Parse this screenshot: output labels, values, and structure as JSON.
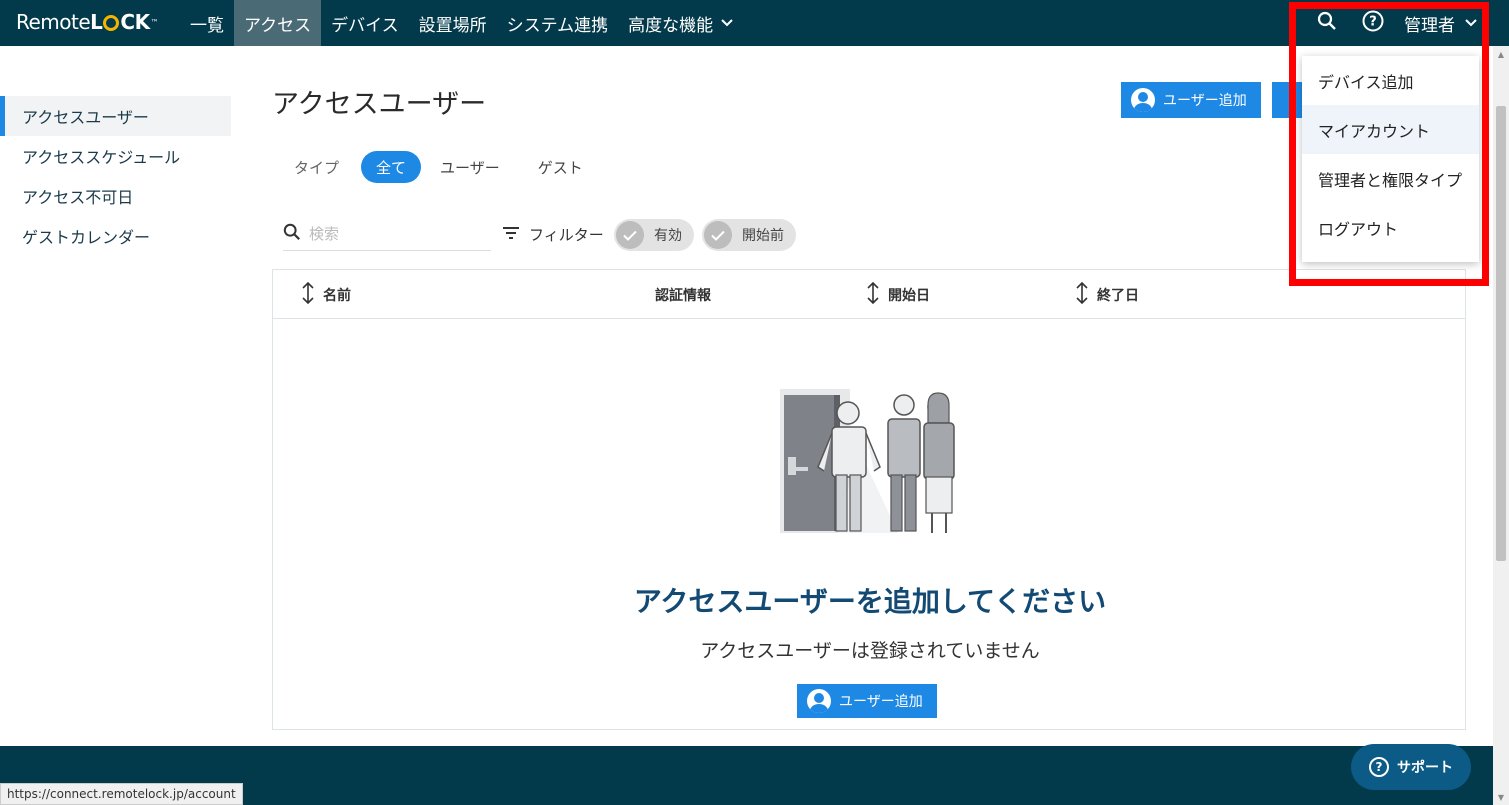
{
  "nav": {
    "logo_part1": "Remote",
    "logo_part2": "L",
    "logo_part3": "CK",
    "logo_tm": "™",
    "items": [
      {
        "label": "一覧"
      },
      {
        "label": "アクセス"
      },
      {
        "label": "デバイス"
      },
      {
        "label": "設置場所"
      },
      {
        "label": "システム連携"
      },
      {
        "label": "高度な機能"
      }
    ],
    "admin_label": "管理者",
    "icons": {
      "search": "search-icon",
      "help": "help-icon"
    }
  },
  "sidebar": {
    "items": [
      {
        "label": "アクセスユーザー"
      },
      {
        "label": "アクセススケジュール"
      },
      {
        "label": "アクセス不可日"
      },
      {
        "label": "ゲストカレンダー"
      }
    ]
  },
  "main": {
    "title": "アクセスユーザー",
    "add_user_label": "ユーザー追加",
    "type_label": "タイプ",
    "type_tabs": [
      {
        "label": "全て"
      },
      {
        "label": "ユーザー"
      },
      {
        "label": "ゲスト"
      }
    ],
    "search_placeholder": "検索",
    "filter_label": "フィルター",
    "chips": [
      {
        "label": "有効"
      },
      {
        "label": "開始前"
      }
    ]
  },
  "table": {
    "columns": [
      {
        "label": "名前"
      },
      {
        "label": "認証情報"
      },
      {
        "label": "開始日"
      },
      {
        "label": "終了日"
      }
    ],
    "empty_title": "アクセスユーザーを追加してください",
    "empty_subtitle": "アクセスユーザーは登録されていません",
    "empty_button_label": "ユーザー追加"
  },
  "dropdown": {
    "items": [
      {
        "label": "デバイス追加"
      },
      {
        "label": "マイアカウント"
      },
      {
        "label": "管理者と権限タイプ"
      },
      {
        "label": "ログアウト"
      }
    ]
  },
  "support_label": "サポート",
  "status_url": "https://connect.remotelock.jp/account",
  "colors": {
    "nav_bg": "#023a4b",
    "accent": "#1e88e5",
    "highlight": "#ff0000",
    "empty_title": "#124a74"
  }
}
